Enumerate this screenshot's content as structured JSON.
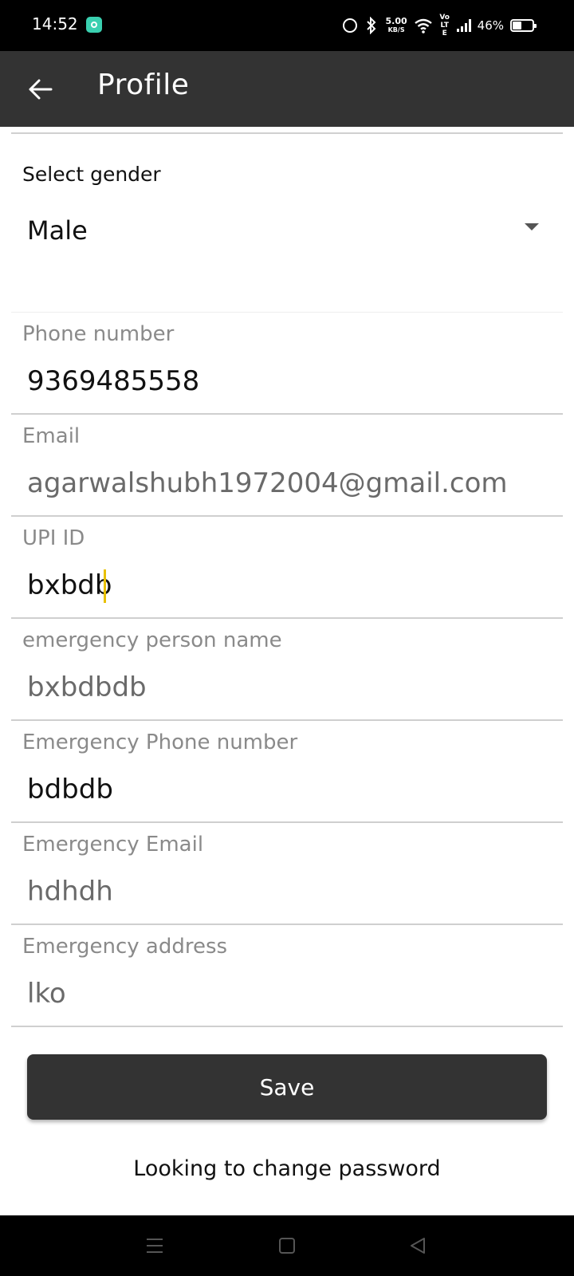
{
  "status_bar": {
    "time": "14:52",
    "net_speed_value": "5.00",
    "net_speed_unit": "KB/S",
    "volte": "Vo LTE",
    "battery_percent": "46%",
    "icons": [
      "app-notification-icon",
      "alarm-icon",
      "bluetooth-icon",
      "wifi-icon",
      "signal-icon",
      "battery-icon"
    ]
  },
  "header": {
    "title": "Profile",
    "back_icon": "arrow-left-icon"
  },
  "form": {
    "gender": {
      "label": "Select gender",
      "value": "Male"
    },
    "fields": [
      {
        "key": "phone",
        "label": "Phone number",
        "value": "9369485558"
      },
      {
        "key": "email",
        "label": "Email",
        "value": "agarwalshubh1972004@gmail.com"
      },
      {
        "key": "upi",
        "label": "UPI ID",
        "value": "bxbdb"
      },
      {
        "key": "emergency_name",
        "label": "emergency person name",
        "value": "bxbdbdb"
      },
      {
        "key": "emergency_phone",
        "label": "Emergency Phone number",
        "value": "bdbdb"
      },
      {
        "key": "emergency_email",
        "label": "Emergency Email",
        "value": "hdhdh"
      },
      {
        "key": "emergency_address",
        "label": "Emergency address",
        "value": "lko"
      }
    ],
    "save_label": "Save",
    "change_password_label": "Looking to change password"
  },
  "colors": {
    "app_bar": "#333333",
    "accent_caret": "#e8c000",
    "label_gray": "#8a8a8a"
  },
  "nav_bar": {
    "icons": [
      "menu-icon",
      "home-square-icon",
      "back-triangle-icon"
    ]
  }
}
